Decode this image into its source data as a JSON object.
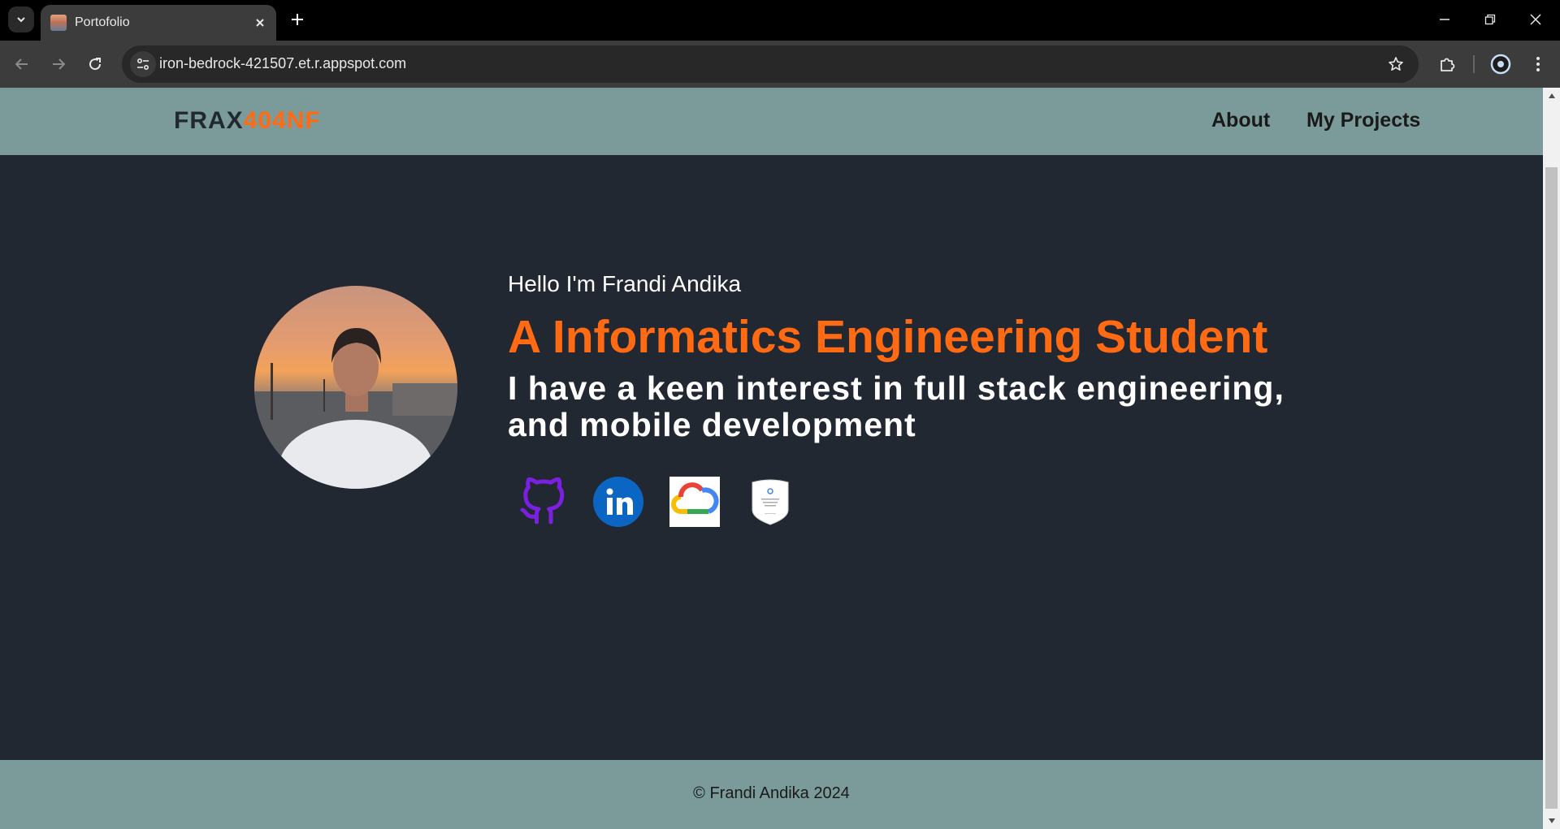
{
  "browser": {
    "tab_title": "Portofolio",
    "url": "iron-bedrock-421507.et.r.appspot.com",
    "icons": [
      "chevron-down-icon",
      "close-icon",
      "plus-icon",
      "minimize-icon",
      "restore-icon",
      "back-icon",
      "forward-icon",
      "reload-icon",
      "site-info-icon",
      "star-icon",
      "extensions-icon",
      "profile-icon",
      "kebab-menu-icon"
    ]
  },
  "site": {
    "logo_part1": "FRAX",
    "logo_part2": "404NF",
    "nav": [
      {
        "label": "About"
      },
      {
        "label": "My Projects"
      }
    ],
    "hero": {
      "greeting": "Hello I'm Frandi Andika",
      "headline": "A Informatics Engineering Student",
      "subline": "I have a keen interest in full stack engineering, and mobile development"
    },
    "social": [
      {
        "icon": "github-icon"
      },
      {
        "icon": "linkedin-icon"
      },
      {
        "icon": "google-cloud-icon"
      },
      {
        "icon": "google-cloud-badge-icon"
      }
    ],
    "footer": "© Frandi Andika 2024"
  },
  "colors": {
    "page_bg": "#222831",
    "header_bg": "#7b9b9a",
    "accent": "#ff6a13",
    "github_purple": "#7b1fe0",
    "linkedin_blue": "#0a66c2"
  }
}
